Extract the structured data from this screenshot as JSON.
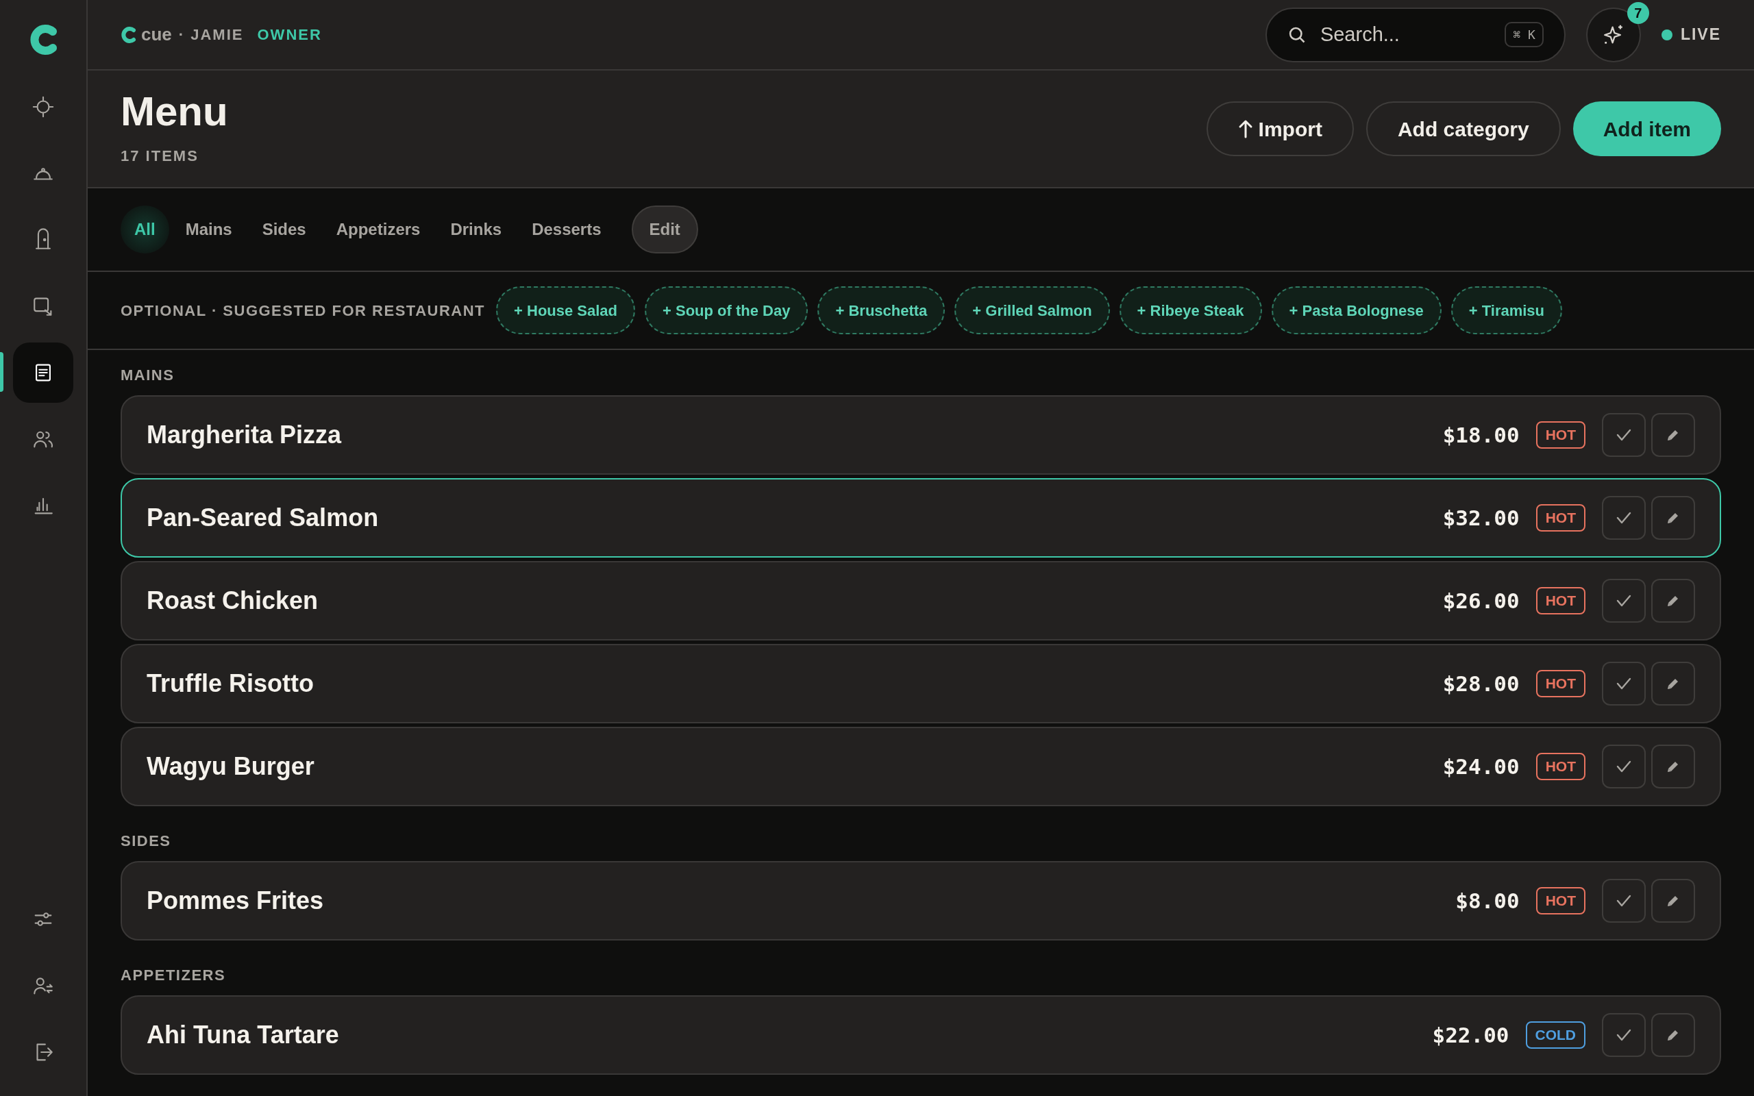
{
  "sidebar": {
    "items": [
      {
        "kind": "target",
        "selected": false
      },
      {
        "kind": "cloche",
        "selected": false
      },
      {
        "kind": "door",
        "selected": false
      },
      {
        "kind": "export",
        "selected": false
      },
      {
        "kind": "document",
        "selected": true
      },
      {
        "kind": "people",
        "selected": false
      },
      {
        "kind": "chart",
        "selected": false
      }
    ],
    "bottom_items": [
      {
        "kind": "sliders"
      },
      {
        "kind": "user-switch"
      },
      {
        "kind": "logout"
      }
    ]
  },
  "header": {
    "brand": "cue",
    "user": "· JAMIE",
    "role": "OWNER",
    "search": {
      "placeholder": "Search...",
      "shortcut": "⌘ K"
    },
    "notifications": "7",
    "status": {
      "label": "LIVE",
      "live": true
    }
  },
  "page": {
    "title": "Menu",
    "subtitle": "17 ITEMS",
    "buttons": [
      {
        "label": "Import",
        "kind": "import"
      },
      {
        "label": "Add category",
        "kind": "secondary"
      },
      {
        "label": "Add item",
        "kind": "primary"
      }
    ]
  },
  "tabs": [
    {
      "label": "All",
      "selected": true
    },
    {
      "label": "Mains",
      "selected": false
    },
    {
      "label": "Sides",
      "selected": false
    },
    {
      "label": "Appetizers",
      "selected": false
    },
    {
      "label": "Drinks",
      "selected": false
    },
    {
      "label": "Desserts",
      "selected": false
    }
  ],
  "edit_button": "Edit",
  "suggestions": {
    "label": "OPTIONAL · SUGGESTED FOR RESTAURANT",
    "chips": [
      "+ House Salad",
      "+ Soup of the Day",
      "+ Bruschetta",
      "+ Grilled Salmon",
      "+ Ribeye Steak",
      "+ Pasta Bolognese",
      "+ Tiramisu"
    ]
  },
  "sections": [
    {
      "title": "MAINS",
      "items": [
        {
          "name": "Margherita Pizza",
          "price": "$18.00",
          "tag": "HOT",
          "color": "#e8735f",
          "selected": false
        },
        {
          "name": "Pan-Seared Salmon",
          "price": "$32.00",
          "tag": "HOT",
          "color": "#e8735f",
          "selected": true
        },
        {
          "name": "Roast Chicken",
          "price": "$26.00",
          "tag": "HOT",
          "color": "#e8735f",
          "selected": false
        },
        {
          "name": "Truffle Risotto",
          "price": "$28.00",
          "tag": "HOT",
          "color": "#e8735f",
          "selected": false
        },
        {
          "name": "Wagyu Burger",
          "price": "$24.00",
          "tag": "HOT",
          "color": "#e8735f",
          "selected": false
        }
      ]
    },
    {
      "title": "SIDES",
      "items": [
        {
          "name": "Pommes Frites",
          "price": "$8.00",
          "tag": "HOT",
          "color": "#e8735f",
          "selected": false
        }
      ]
    },
    {
      "title": "APPETIZERS",
      "items": [
        {
          "name": "Ahi Tuna Tartare",
          "price": "$22.00",
          "tag": "COLD",
          "color": "#4f9fe0",
          "selected": false
        }
      ]
    }
  ]
}
